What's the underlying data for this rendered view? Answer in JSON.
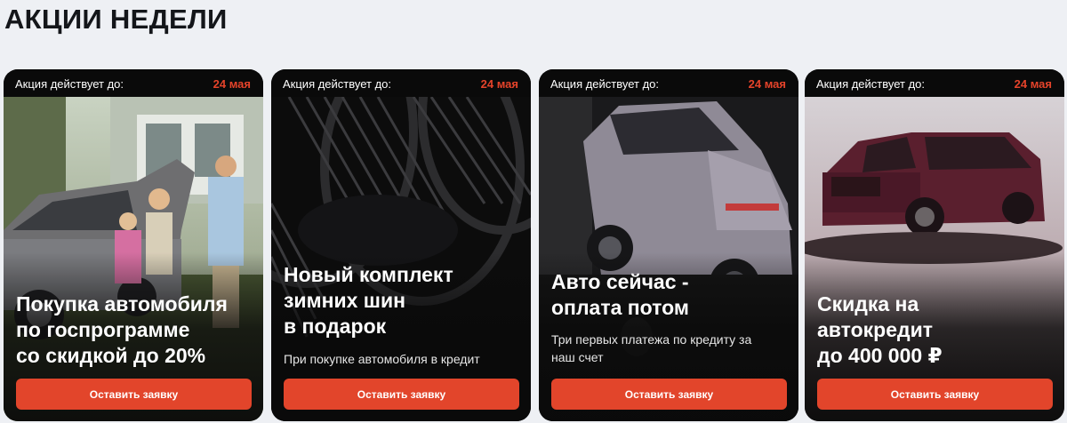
{
  "section": {
    "title": "АКЦИИ НЕДЕЛИ"
  },
  "colors": {
    "accent": "#e2452b",
    "deadline": "#e4432a",
    "card_bg": "#0d0d0d",
    "page_bg": "#eef0f4"
  },
  "cards": [
    {
      "deadline_label": "Акция действует до:",
      "deadline_date": "24 мая",
      "title": "Покупка автомобиля\nпо госпрограмме\nсо скидкой до 20%",
      "description": "",
      "button": "Оставить заявку",
      "image": "family-with-suv-photo"
    },
    {
      "deadline_label": "Акция действует до:",
      "deadline_date": "24 мая",
      "title": "Новый комплект\nзимних шин\nв подарок",
      "description": "При покупке автомобиля в кредит",
      "button": "Оставить заявку",
      "image": "tires-photo"
    },
    {
      "deadline_label": "Акция действует до:",
      "deadline_date": "24 мая",
      "title": "Авто сейчас -\nоплата потом",
      "description": "Три первых платежа по кредиту за\nнаш счет",
      "button": "Оставить заявку",
      "image": "grey-crossover-photo"
    },
    {
      "deadline_label": "Акция действует до:",
      "deadline_date": "24 мая",
      "title": "Скидка на\nавтокредит\nдо 400 000 ₽",
      "description": "",
      "button": "Оставить заявку",
      "image": "burgundy-suv-photo"
    }
  ]
}
